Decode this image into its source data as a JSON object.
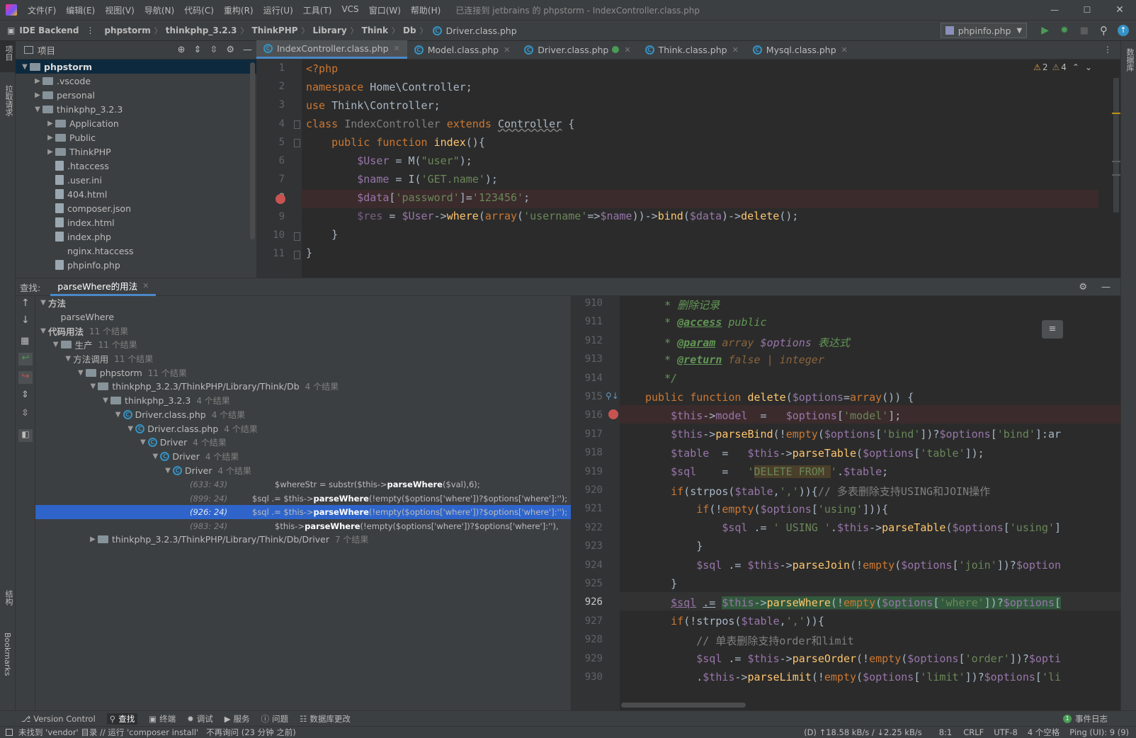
{
  "titlebar": {
    "menus": [
      "文件(F)",
      "编辑(E)",
      "视图(V)",
      "导航(N)",
      "代码(C)",
      "重构(R)",
      "运行(U)",
      "工具(T)",
      "VCS",
      "窗口(W)",
      "帮助(H)"
    ],
    "title": "已连接到 jetbrains 的 phpstorm - IndexController.class.php"
  },
  "navbar": {
    "backend": "IDE Backend",
    "crumbs": [
      "phpstorm",
      "thinkphp_3.2.3",
      "ThinkPHP",
      "Library",
      "Think",
      "Db"
    ],
    "file": "Driver.class.php",
    "run_config": "phpinfo.php"
  },
  "leftstrip": {
    "project": "项目",
    "pull": "拉取请求",
    "structure": "结构",
    "bookmarks": "Bookmarks"
  },
  "rightstrip": {
    "db": "数据库"
  },
  "project": {
    "title": "项目",
    "items": [
      {
        "label": "phpstorm",
        "level": 0,
        "arrow": "down",
        "icon": "folder",
        "bold": true,
        "selected": true
      },
      {
        "label": ".vscode",
        "level": 1,
        "arrow": "right",
        "icon": "folder"
      },
      {
        "label": "personal",
        "level": 1,
        "arrow": "right",
        "icon": "folder"
      },
      {
        "label": "thinkphp_3.2.3",
        "level": 1,
        "arrow": "down",
        "icon": "folder"
      },
      {
        "label": "Application",
        "level": 2,
        "arrow": "right",
        "icon": "folder"
      },
      {
        "label": "Public",
        "level": 2,
        "arrow": "right",
        "icon": "folder"
      },
      {
        "label": "ThinkPHP",
        "level": 2,
        "arrow": "right",
        "icon": "folder"
      },
      {
        "label": ".htaccess",
        "level": 2,
        "arrow": "",
        "icon": "file"
      },
      {
        "label": ".user.ini",
        "level": 2,
        "arrow": "",
        "icon": "file"
      },
      {
        "label": "404.html",
        "level": 2,
        "arrow": "",
        "icon": "file"
      },
      {
        "label": "composer.json",
        "level": 2,
        "arrow": "",
        "icon": "file"
      },
      {
        "label": "index.html",
        "level": 2,
        "arrow": "",
        "icon": "file"
      },
      {
        "label": "index.php",
        "level": 2,
        "arrow": "",
        "icon": "file"
      },
      {
        "label": "nginx.htaccess",
        "level": 2,
        "arrow": "",
        "icon": "none"
      },
      {
        "label": "phpinfo.php",
        "level": 2,
        "arrow": "",
        "icon": "file"
      }
    ]
  },
  "tabs": [
    {
      "label": "IndexController.class.php",
      "active": true
    },
    {
      "label": "Model.class.php"
    },
    {
      "label": "Driver.class.php"
    },
    {
      "label": "Think.class.php"
    },
    {
      "label": "Mysql.class.php"
    }
  ],
  "editor": {
    "inspections": {
      "warnings": "2",
      "weak": "4"
    },
    "line_numbers": [
      "1",
      "2",
      "3",
      "4",
      "5",
      "6",
      "7",
      "8",
      "9",
      "10",
      "11"
    ]
  },
  "find": {
    "label": "查找:",
    "tab": "parseWhere的用法",
    "rows": [
      {
        "label": "方法",
        "level": 0,
        "arrow": "down",
        "icon": "none",
        "count": "",
        "bold": true
      },
      {
        "label": "parseWhere",
        "level": 1,
        "arrow": "",
        "icon": "none",
        "count": ""
      },
      {
        "label": "代码用法",
        "level": 0,
        "arrow": "down",
        "icon": "none",
        "count": "11 个结果",
        "bold": true
      },
      {
        "label": "生产",
        "level": 1,
        "arrow": "down",
        "icon": "folder",
        "count": "11 个结果"
      },
      {
        "label": "方法调用",
        "level": 2,
        "arrow": "down",
        "icon": "none",
        "count": "11 个结果"
      },
      {
        "label": "phpstorm",
        "level": 3,
        "arrow": "down",
        "icon": "folder",
        "count": "11 个结果"
      },
      {
        "label": "thinkphp_3.2.3/ThinkPHP/Library/Think/Db",
        "level": 4,
        "arrow": "down",
        "icon": "folder",
        "count": "4 个结果"
      },
      {
        "label": "thinkphp_3.2.3",
        "level": 5,
        "arrow": "down",
        "icon": "folder",
        "count": "4 个结果"
      },
      {
        "label": "Driver.class.php",
        "level": 6,
        "arrow": "down",
        "icon": "class",
        "count": "4 个结果"
      },
      {
        "label": "Driver.class.php",
        "level": 7,
        "arrow": "down",
        "icon": "class",
        "count": "4 个结果"
      },
      {
        "label": "Driver",
        "level": 8,
        "arrow": "down",
        "icon": "class",
        "count": "4 个结果"
      },
      {
        "label": "Driver",
        "level": 9,
        "arrow": "down",
        "icon": "class",
        "count": "4 个结果"
      },
      {
        "label": "Driver",
        "level": 10,
        "arrow": "down",
        "icon": "class",
        "count": "4 个结果"
      }
    ],
    "usages": [
      {
        "loc": "(633: 43)",
        "pre": "$whereStr = substr($this->",
        "hl": "parseWhere",
        "post": "($val),6);",
        "selected": false
      },
      {
        "loc": "(899: 24)",
        "pre": "$sql .= $this->",
        "hl": "parseWhere",
        "post": "(!empty($options['where'])?$options['where']:'');",
        "selected": false
      },
      {
        "loc": "(926: 24)",
        "pre": "$sql .= $this->",
        "hl": "parseWhere",
        "post": "(!empty($options['where'])?$options['where']:'');",
        "selected": true
      },
      {
        "loc": "(983: 24)",
        "pre": "$this->",
        "hl": "parseWhere",
        "post": "(!empty($options['where'])?$options['where']:''),",
        "selected": false
      }
    ],
    "last": {
      "label": "thinkphp_3.2.3/ThinkPHP/Library/Think/Db/Driver",
      "count": "7 个结果"
    }
  },
  "preview": {
    "line_numbers": [
      "910",
      "911",
      "912",
      "913",
      "914",
      "915",
      "916",
      "917",
      "918",
      "919",
      "920",
      "921",
      "922",
      "923",
      "924",
      "925",
      "926",
      "927",
      "928",
      "929",
      "930"
    ]
  },
  "toolwindows": [
    "Version Control",
    "查找",
    "终端",
    "调试",
    "服务",
    "问题",
    "数据库更改"
  ],
  "event_log": "事件日志",
  "event_count": "1",
  "status": {
    "message": "未找到 'vendor' 目录 // 运行 'composer install'   不再询问 (23 分钟 之前)",
    "network": "(D) ↑18.58 kB/s / ↓2.25 kB/s",
    "position": "8:1",
    "line_sep": "CRLF",
    "encoding": "UTF-8",
    "indent": "4 个空格",
    "ping": "Ping (UI): 9 (9)"
  }
}
